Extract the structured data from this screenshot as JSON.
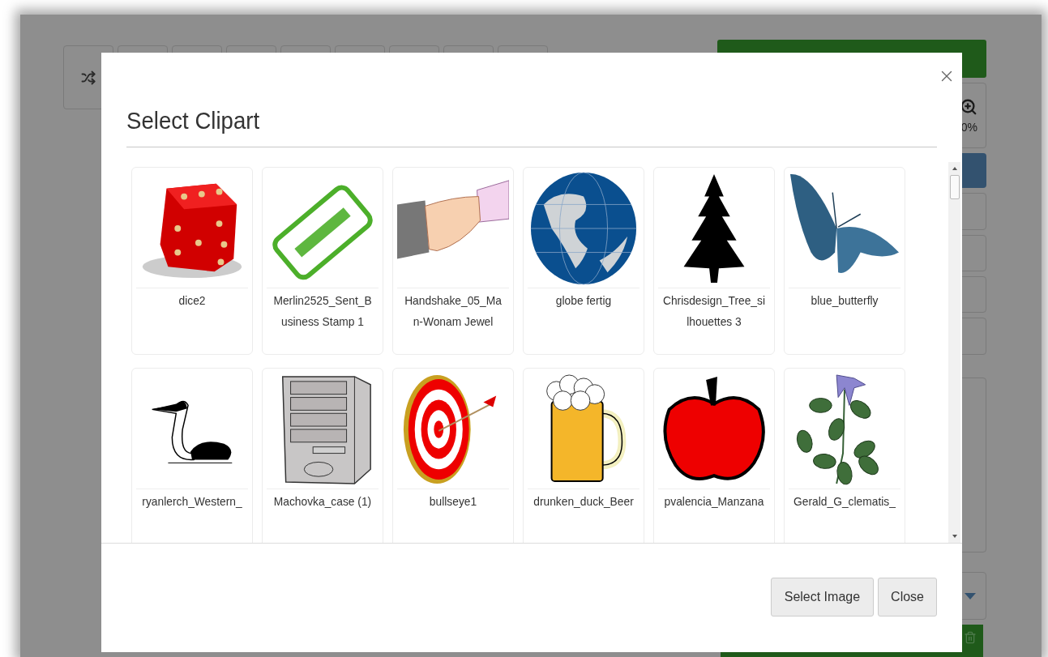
{
  "background": {
    "zoom_reading": "0%"
  },
  "dialog": {
    "title": "Select Clipart",
    "cliparts": [
      {
        "kind": "dice",
        "label": "dice2"
      },
      {
        "kind": "stamp",
        "label": "Merlin2525_Sent_Business Stamp 1"
      },
      {
        "kind": "handshake",
        "label": "Handshake_05_Man-Wonam Jewel"
      },
      {
        "kind": "globe",
        "label": "globe fertig"
      },
      {
        "kind": "tree",
        "label": "Chrisdesign_Tree_silhouettes 3"
      },
      {
        "kind": "butterfly",
        "label": "blue_butterfly"
      },
      {
        "kind": "bird",
        "label": "ryanlerch_Western_"
      },
      {
        "kind": "computer",
        "label": "Machovka_case (1)"
      },
      {
        "kind": "target",
        "label": "bullseye1"
      },
      {
        "kind": "beer",
        "label": "drunken_duck_Beer"
      },
      {
        "kind": "apple",
        "label": "pvalencia_Manzana"
      },
      {
        "kind": "flower",
        "label": "Gerald_G_clematis_"
      }
    ],
    "buttons": [
      {
        "kind": "select",
        "label": "Select Image"
      },
      {
        "kind": "close",
        "label": "Close"
      }
    ]
  }
}
